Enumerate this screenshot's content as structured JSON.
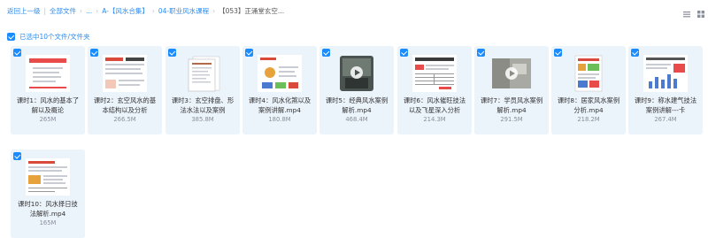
{
  "breadcrumb": {
    "back": "返回上一级",
    "all_files": "全部文件",
    "ellipsis": "...",
    "level1": "A-【风水合集】",
    "level2": "04-职业风水课程",
    "current": "【053】正涌堂玄空..."
  },
  "toolbar": {
    "icons": [
      "list-view-icon",
      "grid-view-icon"
    ]
  },
  "selection": {
    "label": "已选中10个文件/文件夹"
  },
  "files": [
    {
      "name": "课时1：风水的基本了解以及概论",
      "size": "265M",
      "thumb": "doc-cover"
    },
    {
      "name": "课时2：玄空风水的基本结构以及分析",
      "size": "266.5M",
      "thumb": "doc-slides"
    },
    {
      "name": "课时3：玄空排盘、形法水法以及案例",
      "size": "385.8M",
      "thumb": "doc-pages"
    },
    {
      "name": "课时4：风水化煞以及案例讲解.mp4",
      "size": "180.8M",
      "thumb": "doc-diagram"
    },
    {
      "name": "课时5：经典风水案例解析.mp4",
      "size": "468.4M",
      "thumb": "video-dark"
    },
    {
      "name": "课时6：风水催旺技法以及飞星深入分析",
      "size": "214.3M",
      "thumb": "doc-table"
    },
    {
      "name": "课时7：学员风水案例解析.mp4",
      "size": "291.5M",
      "thumb": "video-gray"
    },
    {
      "name": "课时8：居家风水案例分析.mp4",
      "size": "218.2M",
      "thumb": "doc-color"
    },
    {
      "name": "课时9：称水建气技法案例讲解---卡",
      "size": "267.4M",
      "thumb": "doc-chart"
    },
    {
      "name": "课时10：风水择日技法解析.mp4",
      "size": "165M",
      "thumb": "doc-chart2"
    }
  ],
  "colors": {
    "accent": "#1a8cff",
    "link": "#2d8cf0",
    "card_bg": "#ebf3fb"
  }
}
